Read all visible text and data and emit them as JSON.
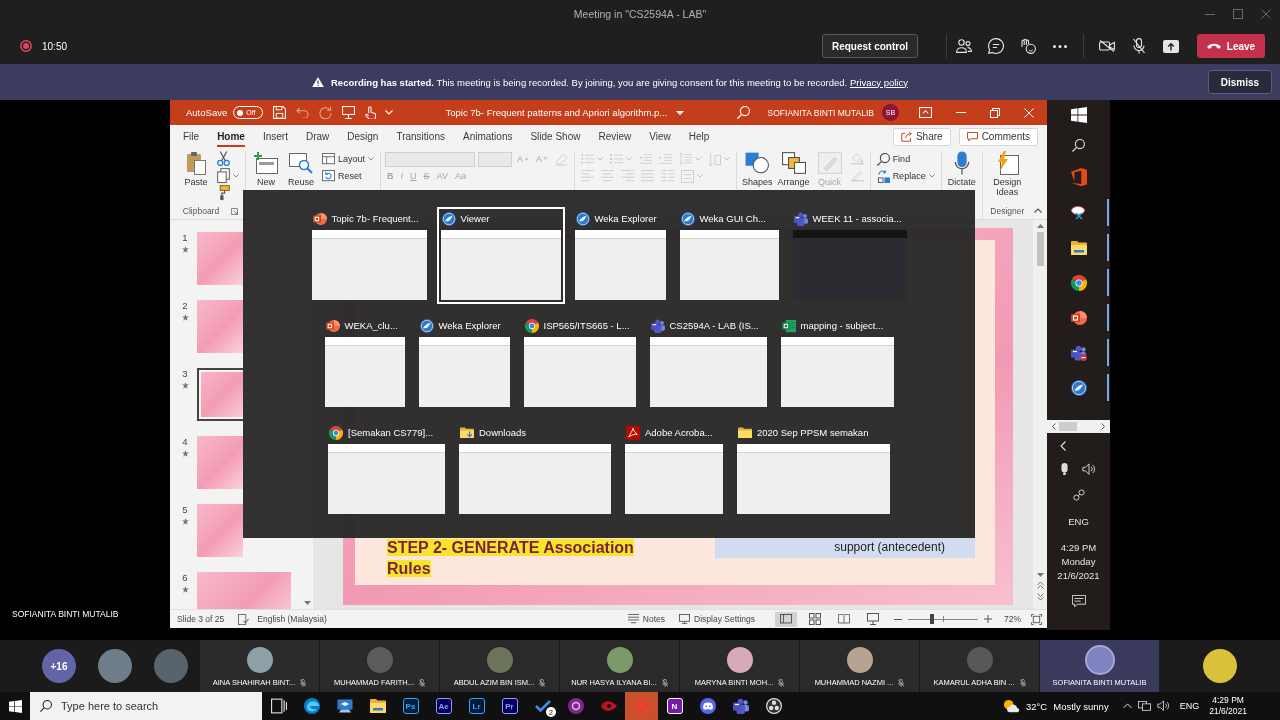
{
  "teams_window": {
    "title": "Meeting in \"CS2594A - LAB\""
  },
  "meeting_bar": {
    "recording": true,
    "duration": "10:50",
    "request_control": "Request control",
    "camera_on": false,
    "mic_on": false,
    "leave": "Leave"
  },
  "recording_banner": {
    "message": "**Recording has started.** This meeting is being recorded. By joining, you are giving consent for this meeting to be recorded.",
    "link": "Privacy policy",
    "dismiss": "Dismiss"
  },
  "shared_screen": {
    "presenter": "SOFIANITA BINTI MUTALIB",
    "powerpoint": {
      "title_bar": {
        "autosave": "AutoSave",
        "autosave_on": false,
        "autosave_state": "Off",
        "document": "Topic 7b- Frequent patterns and Apriori algorithm.p...",
        "user": "SOFIANITA BINTI MUTALIB",
        "initials": "SB"
      },
      "tabs": [
        {
          "label": "File",
          "selected": false
        },
        {
          "label": "Home",
          "selected": true
        },
        {
          "label": "Insert",
          "selected": false
        },
        {
          "label": "Draw",
          "selected": false
        },
        {
          "label": "Design",
          "selected": false
        },
        {
          "label": "Transitions",
          "selected": false
        },
        {
          "label": "Animations",
          "selected": false
        },
        {
          "label": "Slide Show",
          "selected": false
        },
        {
          "label": "Review",
          "selected": false
        },
        {
          "label": "View",
          "selected": false
        },
        {
          "label": "Help",
          "selected": false
        }
      ],
      "share": "Share",
      "comments": "Comments",
      "ribbon": [
        {
          "label": "Clipboard",
          "launcher": true,
          "large": [
            {
              "kind": "paste",
              "label": "Paste",
              "disabled": false
            }
          ],
          "rows": [
            [
              {
                "kind": "cut",
                "disabled": false
              }
            ],
            [
              {
                "kind": "copy",
                "disabled": false
              }
            ],
            [
              {
                "kind": "format_painter",
                "disabled": false
              }
            ]
          ]
        },
        {
          "large": [
            {
              "kind": "new_slide",
              "label": "New",
              "disabled": false
            },
            {
              "kind": "reuse_slides",
              "label": "Reuse",
              "disabled": false
            }
          ],
          "rows": [
            [
              {
                "kind": "layout",
                "label": "Layout",
                "disabled": false
              }
            ],
            [
              {
                "kind": "reset",
                "label": "Reset",
                "disabled": false
              }
            ]
          ]
        },
        {
          "rows": [
            [
              {
                "kind": "font_name",
                "disabled": true
              },
              {
                "kind": "font_size",
                "disabled": true
              },
              {
                "kind": "grow_font",
                "label": "A",
                "disabled": true
              },
              {
                "kind": "shrink_font",
                "label": "A",
                "disabled": true
              },
              {
                "kind": "clear_format",
                "disabled": true
              }
            ],
            [
              {
                "kind": "bold",
                "label": "B",
                "disabled": true
              },
              {
                "kind": "italic",
                "label": "I",
                "disabled": true
              },
              {
                "kind": "underline",
                "label": "U",
                "disabled": true
              },
              {
                "kind": "strike",
                "label": "S",
                "disabled": true
              },
              {
                "kind": "spacing",
                "label": "AV",
                "disabled": true
              },
              {
                "kind": "case",
                "label": "Aa",
                "disabled": true
              }
            ]
          ]
        },
        {
          "rows": [
            [
              {
                "kind": "bullets",
                "disabled": true
              },
              {
                "kind": "numbering",
                "disabled": true
              },
              {
                "kind": "indent_dec",
                "disabled": true
              },
              {
                "kind": "indent_inc",
                "disabled": true
              },
              {
                "kind": "line_spacing",
                "disabled": true
              },
              {
                "kind": "text_direction",
                "disabled": true
              }
            ],
            [
              {
                "kind": "align_left",
                "disabled": true
              },
              {
                "kind": "align_center",
                "disabled": true
              },
              {
                "kind": "align_right",
                "disabled": true
              },
              {
                "kind": "justify",
                "disabled": true
              },
              {
                "kind": "columns",
                "disabled": true
              },
              {
                "kind": "align_text",
                "disabled": true
              }
            ]
          ]
        },
        {
          "large": [
            {
              "kind": "shapes",
              "label": "Shapes",
              "disabled": false
            },
            {
              "kind": "arrange",
              "label": "Arrange",
              "disabled": false
            },
            {
              "kind": "quick_styles",
              "label": "Quick",
              "disabled": true
            }
          ],
          "rows": [
            [
              {
                "kind": "fill",
                "disabled": true
              }
            ],
            [
              {
                "kind": "outline",
                "disabled": true
              }
            ]
          ]
        },
        {
          "rows": [
            [
              {
                "kind": "find",
                "label": "Find",
                "disabled": false
              }
            ],
            [
              {
                "kind": "replace",
                "label": "Replace",
                "disabled": false
              }
            ]
          ]
        },
        {
          "large": [
            {
              "kind": "dictate",
              "label": "Dictate",
              "disabled": false
            }
          ]
        },
        {
          "label": "Designer",
          "large": [
            {
              "kind": "design_ideas",
              "label": "Design Ideas",
              "disabled": false
            }
          ]
        }
      ],
      "slides": [
        {
          "number": "1",
          "animated": true,
          "selected": false
        },
        {
          "number": "2",
          "animated": true,
          "selected": false
        },
        {
          "number": "3",
          "animated": true,
          "selected": true
        },
        {
          "number": "4",
          "animated": true,
          "selected": false
        },
        {
          "number": "5",
          "animated": true,
          "selected": false
        },
        {
          "number": "6",
          "animated": true,
          "selected": false
        }
      ],
      "slide": {
        "heading": "STEP 2- GENERATE Association Rules",
        "denominator": "support (antecedent)"
      },
      "status_bar": {
        "position": "Slide 3 of 25",
        "language": "English (Malaysia)",
        "notes": "Notes",
        "display_settings": "Display Settings",
        "views": [
          {
            "kind": "normal",
            "selected": true
          },
          {
            "kind": "sorter",
            "selected": false
          },
          {
            "kind": "reading",
            "selected": false
          },
          {
            "kind": "slideshow",
            "selected": false
          }
        ],
        "zoom": {
          "level": 0.35
        },
        "zoom_reading": "72%"
      }
    },
    "task_switcher": {
      "rows": [
        [
          {
            "kind": "powerpoint",
            "title": "Topic 7b- Frequent...",
            "selected": false,
            "dark_preview": false
          },
          {
            "kind": "weka",
            "title": "Viewer",
            "selected": true,
            "dark_preview": false
          },
          {
            "kind": "weka",
            "title": "Weka Explorer",
            "selected": false,
            "dark_preview": false
          },
          {
            "kind": "weka",
            "title": "Weka GUI Ch...",
            "selected": false,
            "dark_preview": false
          },
          {
            "kind": "teams",
            "title": "WEEK 11 - associa...",
            "selected": false,
            "dark_preview": true
          }
        ],
        [
          {
            "kind": "powerpoint",
            "title": "WEKA_clu...",
            "selected": false,
            "dark_preview": false
          },
          {
            "kind": "weka",
            "title": "Weka Explorer",
            "selected": false,
            "dark_preview": false
          },
          {
            "kind": "chrome",
            "title": "ISP565/ITS665 - L...",
            "selected": false,
            "dark_preview": false
          },
          {
            "kind": "teams",
            "title": "CS2594A - LAB (IS...",
            "selected": false,
            "dark_preview": false
          },
          {
            "kind": "excel",
            "title": "mapping - subject...",
            "selected": false,
            "dark_preview": false
          }
        ],
        [
          {
            "kind": "chrome",
            "title": "[Semakan CS779]...",
            "selected": false,
            "dark_preview": false
          },
          {
            "kind": "downloads",
            "title": "Downloads",
            "selected": false,
            "dark_preview": false
          },
          {
            "kind": "acrobat",
            "title": "Adobe Acroba...",
            "selected": false,
            "dark_preview": false
          },
          {
            "kind": "folder",
            "title": "2020 Sep PPSM semakan",
            "selected": false,
            "dark_preview": false
          }
        ]
      ]
    },
    "side_taskbar": {
      "apps": [
        {
          "kind": "office",
          "running": false
        },
        {
          "kind": "snip",
          "running": true
        },
        {
          "kind": "explorer",
          "running": true
        },
        {
          "kind": "chrome",
          "running": true
        },
        {
          "kind": "powerpoint",
          "running": true
        },
        {
          "kind": "teams_busy",
          "running": true
        },
        {
          "kind": "weka",
          "running": true
        }
      ],
      "language": "ENG",
      "time": "4:29 PM",
      "day": "Monday",
      "date": "21/6/2021"
    }
  },
  "participants": [
    {
      "kind": "overflow",
      "count": "+16"
    },
    {
      "kind": "avatar"
    },
    {
      "kind": "avatar"
    },
    {
      "kind": "tile",
      "name": "AINA SHAHIRAH BINT...",
      "muted": true,
      "speaking": false
    },
    {
      "kind": "tile",
      "name": "MUHAMMAD FARITH...",
      "muted": true,
      "speaking": false
    },
    {
      "kind": "tile",
      "name": "ABDUL AZIM BIN ISM...",
      "muted": true,
      "speaking": false
    },
    {
      "kind": "tile",
      "name": "NUR HASYA ILYANA BI...",
      "muted": true,
      "speaking": false
    },
    {
      "kind": "tile",
      "name": "MARYNA BINTI MOH...",
      "muted": true,
      "speaking": false
    },
    {
      "kind": "tile",
      "name": "MUHAMMAD NAZMI ...",
      "muted": true,
      "speaking": false
    },
    {
      "kind": "tile",
      "name": "KAMARUL ADHA BIN ...",
      "muted": true,
      "speaking": false
    },
    {
      "kind": "tile",
      "name": "SOFIANITA BINTI MUTALIB",
      "muted": false,
      "speaking": true
    },
    {
      "kind": "avatar"
    }
  ],
  "taskbar": {
    "search": {
      "placeholder": "Type here to search"
    },
    "apps": [
      {
        "kind": "task_view",
        "flashing": false
      },
      {
        "kind": "edge",
        "flashing": false
      },
      {
        "kind": "remote",
        "flashing": false
      },
      {
        "kind": "explorer",
        "flashing": false
      },
      {
        "kind": "photoshop",
        "label": "Ps",
        "flashing": false
      },
      {
        "kind": "after_effects",
        "label": "Ae",
        "flashing": false
      },
      {
        "kind": "lightroom",
        "label": "Lr",
        "flashing": false
      },
      {
        "kind": "premiere",
        "label": "Pr",
        "flashing": false
      },
      {
        "kind": "todo",
        "badge": "2",
        "flashing": false
      },
      {
        "kind": "ring_app",
        "flashing": false
      },
      {
        "kind": "eye_app",
        "flashing": false
      },
      {
        "kind": "target_app",
        "flashing": true
      },
      {
        "kind": "onenote",
        "label": "N",
        "flashing": false
      },
      {
        "kind": "discord",
        "flashing": false
      },
      {
        "kind": "teams",
        "flashing": false
      },
      {
        "kind": "obs",
        "flashing": false
      }
    ],
    "weather": {
      "temperature": "32°C",
      "condition": "Mostly sunny"
    },
    "language": "ENG",
    "time": "4:29 PM",
    "date": "21/6/2021"
  }
}
